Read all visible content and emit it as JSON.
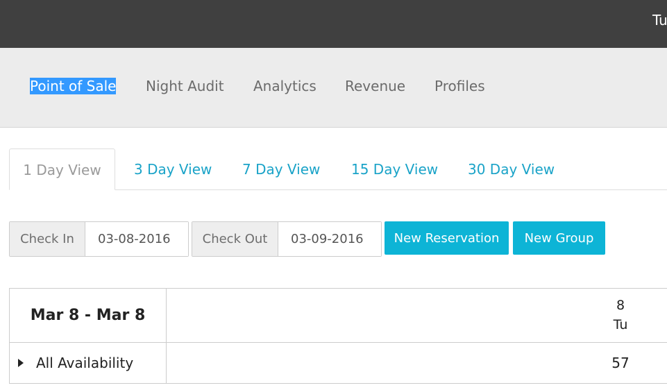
{
  "topbar": {
    "user_text": "Tu"
  },
  "nav": {
    "items": [
      {
        "label": "Point of Sale"
      },
      {
        "label": "Night Audit"
      },
      {
        "label": "Analytics"
      },
      {
        "label": "Revenue"
      },
      {
        "label": "Profiles"
      }
    ],
    "selected": "Point of Sale"
  },
  "view_tabs": {
    "items": [
      {
        "label": "1 Day View"
      },
      {
        "label": "3 Day View"
      },
      {
        "label": "7 Day View"
      },
      {
        "label": "15 Day View"
      },
      {
        "label": "30 Day View"
      }
    ],
    "active": "1 Day View"
  },
  "booking_form": {
    "check_in_label": "Check In",
    "check_in_value": "03-08-2016",
    "check_out_label": "Check Out",
    "check_out_value": "03-09-2016",
    "new_reservation_label": "New Reservation",
    "new_group_label": "New Group"
  },
  "availability_grid": {
    "date_range": "Mar 8 - Mar 8",
    "day_number": "8",
    "day_name": "Tu",
    "rows": [
      {
        "label": "All Availability",
        "value": "57"
      }
    ]
  },
  "colors": {
    "topbar": "#404040",
    "nav_background": "#ececec",
    "selection": "#3399ff",
    "accent": "#0db4d6",
    "tab_link": "#1aa3c8"
  }
}
